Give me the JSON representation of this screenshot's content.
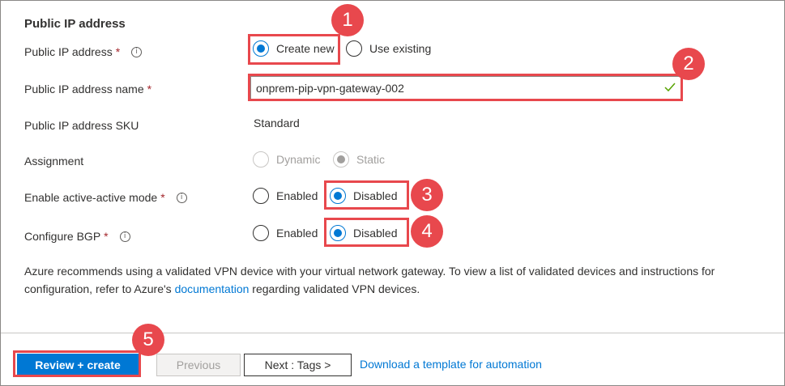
{
  "section_title": "Public IP address",
  "rows": {
    "public_ip": {
      "label": "Public IP address",
      "required": "*",
      "info": "i",
      "options": [
        "Create new",
        "Use existing"
      ],
      "selected": "Create new"
    },
    "public_ip_name": {
      "label": "Public IP address name",
      "required": "*",
      "value": "onprem-pip-vpn-gateway-002"
    },
    "sku": {
      "label": "Public IP address SKU",
      "value": "Standard"
    },
    "assignment": {
      "label": "Assignment",
      "options": [
        "Dynamic",
        "Static"
      ],
      "selected": "Static",
      "disabled": true
    },
    "active_active": {
      "label": "Enable active-active mode",
      "required": "*",
      "info": "i",
      "options": [
        "Enabled",
        "Disabled"
      ],
      "selected": "Disabled"
    },
    "bgp": {
      "label": "Configure BGP",
      "required": "*",
      "info": "i",
      "options": [
        "Enabled",
        "Disabled"
      ],
      "selected": "Disabled"
    }
  },
  "note": {
    "text_before": "Azure recommends using a validated VPN device with your virtual network gateway. To view a list of validated devices and instructions for configuration, refer to Azure's ",
    "link": "documentation",
    "text_after": " regarding validated VPN devices."
  },
  "footer": {
    "review_create": "Review + create",
    "previous": "Previous",
    "next": "Next : Tags >",
    "download_template": "Download a template for automation"
  },
  "callouts": [
    "1",
    "2",
    "3",
    "4",
    "5"
  ],
  "colors": {
    "accent": "#0078d4",
    "callout": "#e8484d",
    "required": "#a4262c"
  },
  "icons": {
    "info": "info-icon",
    "valid": "checkmark-icon"
  }
}
